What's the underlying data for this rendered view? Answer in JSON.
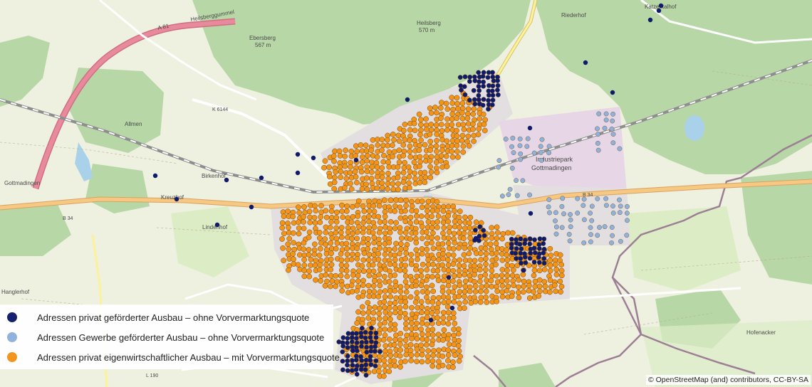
{
  "colors": {
    "private_funded": "#101a6b",
    "business_funded": "#8fb1dc",
    "private_own": "#f39318",
    "forest": "#b7d7a6",
    "meadow": "#dcedc6",
    "base": "#eef0e0",
    "settlement": "#e3dfe1",
    "industrial": "#e7d7e6",
    "motorway": "#e8899c",
    "primary_road": "#f7c884",
    "railway": "#8e8e8e",
    "water": "#a9d2ea",
    "boundary": "#9d7f95"
  },
  "legend": {
    "items": [
      {
        "key": "private_funded",
        "label": "Adressen privat geförderter Ausbau – ohne Vorvermarktungsquote"
      },
      {
        "key": "business_funded",
        "label": "Adressen Gewerbe geförderter Ausbau – ohne Vorvermarktungsquote"
      },
      {
        "key": "private_own",
        "label": "Adressen privat eigenwirtschaftlicher Ausbau – mit Vorvermarktungsquote"
      }
    ]
  },
  "attribution": "© OpenStreetMap (and) contributors, CC-BY-SA",
  "map_labels": {
    "a81": "A 81",
    "hegau": "Heilsberggummel",
    "ebersberg": "Ebersberg",
    "ebersberg_ele": "567 m",
    "heilsberg": "Heilsberg",
    "heilsberg_ele": "570 m",
    "riederhof": "Riederhof",
    "katzental": "Katzentalhof",
    "k6144": "K 6144",
    "allmen": "Allmen",
    "birkenhof": "Birkenhof",
    "kreuzhof": "Kreuzhof",
    "gottmadingen": "Gottmadingen",
    "b34_left": "B 34",
    "b34_right": "B 34",
    "lindenhof": "Lindenhof",
    "industriepark1": "Industriepark",
    "industriepark2": "Gottmadingen",
    "hanglerhof": "Hanglerhof",
    "hofenacker": "Hofenacker",
    "l190": "L 190"
  }
}
